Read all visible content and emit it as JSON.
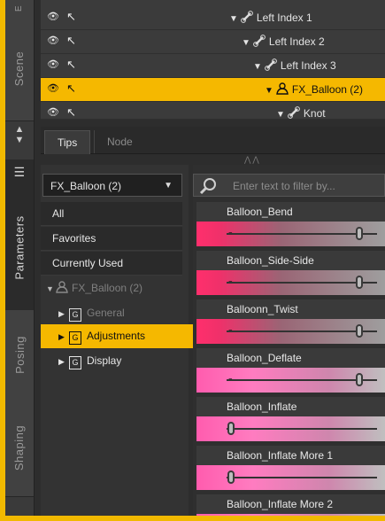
{
  "vertical_tabs": [
    "Scene",
    "Parameters",
    "Posing",
    "Shaping"
  ],
  "scene": {
    "rows": [
      {
        "name": "Left Index 1",
        "selected": false
      },
      {
        "name": "Left Index 2",
        "selected": false
      },
      {
        "name": "Left Index 3",
        "selected": false
      },
      {
        "name": "FX_Balloon (2)",
        "selected": true
      },
      {
        "name": "Knot",
        "selected": false
      }
    ]
  },
  "tabs": {
    "tips": "Tips",
    "node": "Node"
  },
  "dropdown": {
    "value": "FX_Balloon (2)"
  },
  "filter": {
    "placeholder": "Enter text to filter by..."
  },
  "categories": [
    "All",
    "Favorites",
    "Currently Used"
  ],
  "tree": {
    "root": "FX_Balloon (2)",
    "groups": [
      {
        "icon": "G",
        "label": "General",
        "selected": false
      },
      {
        "icon": "G",
        "label": "Adjustments",
        "selected": true
      },
      {
        "icon": "G",
        "label": "Display",
        "selected": false
      }
    ]
  },
  "params": [
    {
      "label": "Balloon_Bend",
      "level": 0.88,
      "color": "#f0306a"
    },
    {
      "label": "Balloon_Side-Side",
      "level": 0.88,
      "color": "#f0306a"
    },
    {
      "label": "Balloonn_Twist",
      "level": 0.88,
      "color": "#f0306a"
    },
    {
      "label": "Balloon_Deflate",
      "level": 0.88,
      "color": "#ff70b8"
    },
    {
      "label": "Balloon_Inflate",
      "level": 0.03,
      "color": "#ff70b8"
    },
    {
      "label": "Balloon_Inflate More 1",
      "level": 0.03,
      "color": "#ff70b8"
    },
    {
      "label": "Balloon_Inflate More 2",
      "level": 0.03,
      "color": "#ff70b8"
    }
  ]
}
